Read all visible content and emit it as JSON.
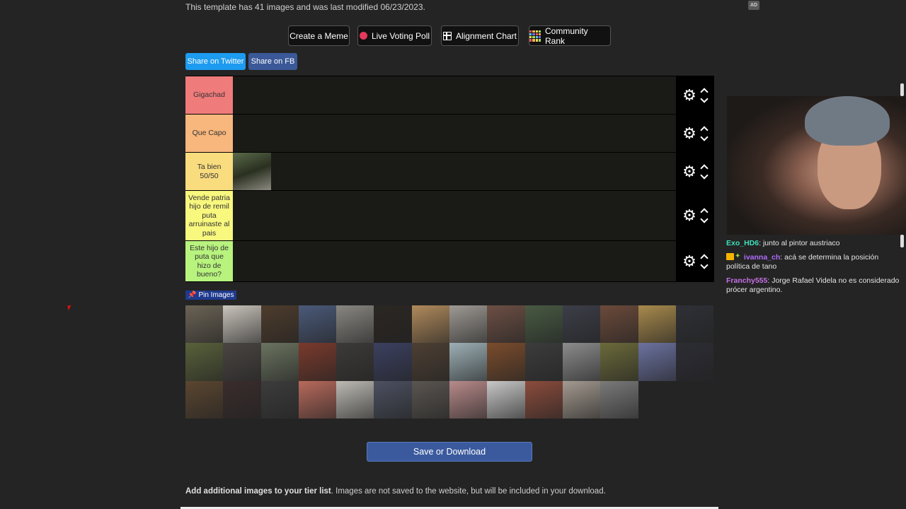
{
  "info_text": "This template has 41 images and was last modified 06/23/2023.",
  "ad_badge": "AD",
  "toolbar": {
    "create_meme": "Create a Meme",
    "live_poll": "Live Voting Poll",
    "alignment_chart": "Alignment Chart",
    "community_rank": "Community Rank"
  },
  "share": {
    "twitter": "Share on Twitter",
    "facebook": "Share on FB"
  },
  "tiers": [
    {
      "label": "Gigachad",
      "color": "#f07b7b"
    },
    {
      "label": "Que Capo",
      "color": "#f7b77d"
    },
    {
      "label": "Ta bien 50/50",
      "color": "#f9dc7e"
    },
    {
      "label": "Vende patria hijo de remil puta arruinaste al pais",
      "color": "#f8f77e"
    },
    {
      "label": "Este hijo de puta que hizo de bueno?",
      "color": "#b8f37e"
    }
  ],
  "pin_images": "Pin Images",
  "pool_colors": [
    "#6b6355",
    "#c9c4bc",
    "#4d3c2c",
    "#4b5a7a",
    "#8a8782",
    "#2b2622",
    "#b08a5c",
    "#9e9a94",
    "#6c4f44",
    "#485a43",
    "#3c3e48",
    "#6b4a3a",
    "#a88a4c",
    "#2f3036",
    "#59613a",
    "#4a4542",
    "#6a735f",
    "#7a3a2c",
    "#3c3a38",
    "#3b4060",
    "#4d3f33",
    "#9db0b6",
    "#7b4c2c",
    "#3c3c3c",
    "#8c8c8c",
    "#6b6a3a",
    "#6b72a0",
    "#2c2c34",
    "#5b4630",
    "#3a2c2c",
    "#3c3c3c",
    "#b86a5c",
    "#bdbab4",
    "#4c5060",
    "#5a5550",
    "#b88a8a",
    "#c8c8c8",
    "#8c4c3c",
    "#a49a90",
    "#7a7a7a"
  ],
  "save_button": "Save or Download",
  "bottom": {
    "bold": "Add additional images to your tier list",
    "rest": ". Images are not saved to the website, but will be included in your download."
  },
  "chat": [
    {
      "user": "Exo_HD6",
      "color": "#3de0b8",
      "text": "junto al pintor austriaco"
    },
    {
      "user": "ivanna_ch",
      "color": "#b06cff",
      "text": "acá se determina la posición política de tano"
    },
    {
      "user": "Franchy555",
      "color": "#c870e8",
      "text": "Jorge Rafael Videla no es considerado prócer argentino."
    }
  ]
}
